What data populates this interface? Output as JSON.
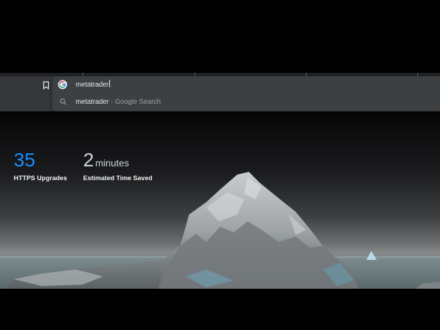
{
  "omnibox": {
    "query": "metatrader",
    "suggestion": {
      "query": "metatrader",
      "separator": "-",
      "suffix": "Google Search"
    }
  },
  "stats": {
    "upgrades": {
      "value": "35",
      "label": "HTTPS Upgrades"
    },
    "time_saved": {
      "value": "2",
      "unit": "minutes",
      "label": "Estimated Time Saved"
    }
  },
  "colors": {
    "toolbar": "#35363a",
    "omnibox": "#3c4043",
    "accent_blue": "#1a8cff"
  },
  "icons": {
    "bookmark": "bookmark-icon",
    "google": "google-logo-icon",
    "search": "search-icon"
  }
}
